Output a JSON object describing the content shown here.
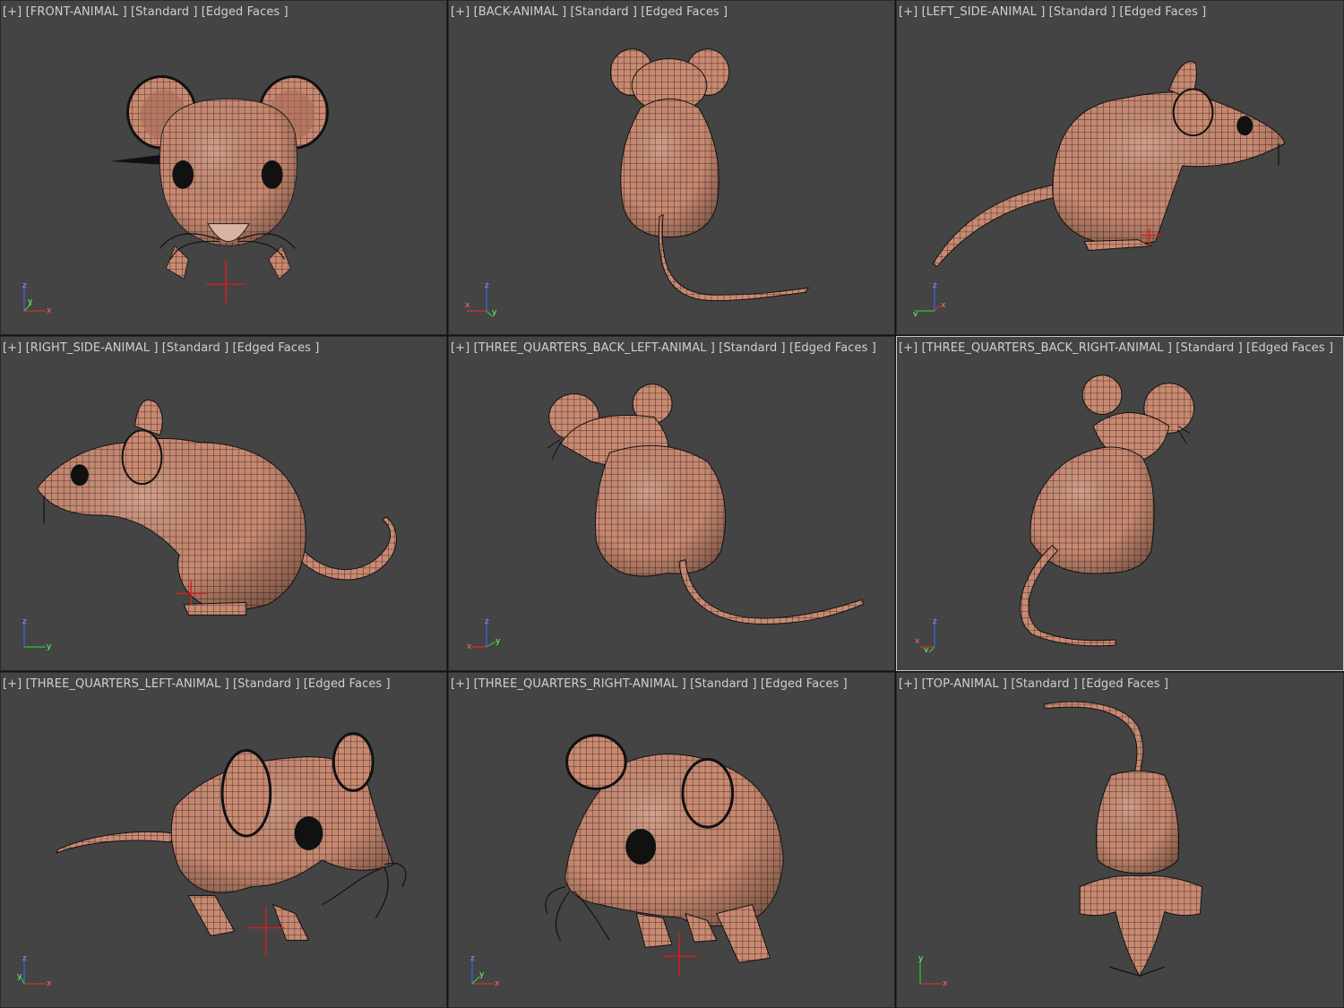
{
  "viewports": [
    {
      "menu": "[+]",
      "name": "[FRONT-ANIMAL ]",
      "shading": "[Standard ]",
      "edges": "[Edged Faces ]",
      "axis": {
        "up": "z",
        "h": "x",
        "d": "y"
      }
    },
    {
      "menu": "[+]",
      "name": "[BACK-ANIMAL ]",
      "shading": "[Standard ]",
      "edges": "[Edged Faces ]",
      "axis": {
        "up": "z",
        "h": "x",
        "d": "y"
      }
    },
    {
      "menu": "[+]",
      "name": "[LEFT_SIDE-ANIMAL ]",
      "shading": "[Standard ]",
      "edges": "[Edged Faces ]",
      "axis": {
        "up": "z",
        "h": "x",
        "d": "y"
      }
    },
    {
      "menu": "[+]",
      "name": "[RIGHT_SIDE-ANIMAL ]",
      "shading": "[Standard ]",
      "edges": "[Edged Faces ]",
      "axis": {
        "up": "z",
        "h": "y",
        "d": ""
      }
    },
    {
      "menu": "[+]",
      "name": "[THREE_QUARTERS_BACK_LEFT-ANIMAL ]",
      "shading": "[Standard ]",
      "edges": "[Edged Faces ]",
      "axis": {
        "up": "z",
        "h": "y",
        "d": "x"
      }
    },
    {
      "menu": "[+]",
      "name": "[THREE_QUARTERS_BACK_RIGHT-ANIMAL ]",
      "shading": "[Standard ]",
      "edges": "[Edged Faces ]",
      "axis": {
        "up": "z",
        "h": "x",
        "d": "y"
      }
    },
    {
      "menu": "[+]",
      "name": "[THREE_QUARTERS_LEFT-ANIMAL ]",
      "shading": "[Standard ]",
      "edges": "[Edged Faces ]",
      "axis": {
        "up": "z",
        "h": "x",
        "d": "y"
      }
    },
    {
      "menu": "[+]",
      "name": "[THREE_QUARTERS_RIGHT-ANIMAL ]",
      "shading": "[Standard ]",
      "edges": "[Edged Faces ]",
      "axis": {
        "up": "z",
        "h": "x",
        "d": "y"
      }
    },
    {
      "menu": "[+]",
      "name": "[TOP-ANIMAL ]",
      "shading": "[Standard ]",
      "edges": "[Edged Faces ]",
      "axis": {
        "up": "y",
        "h": "x",
        "d": ""
      }
    }
  ],
  "colors": {
    "background": "#444444",
    "mesh": "#c98a72",
    "wire": "#2a1a14",
    "pivot": "#d81e1e",
    "axis_x": "#d83030",
    "axis_y": "#30c030",
    "axis_z": "#4060e0"
  }
}
